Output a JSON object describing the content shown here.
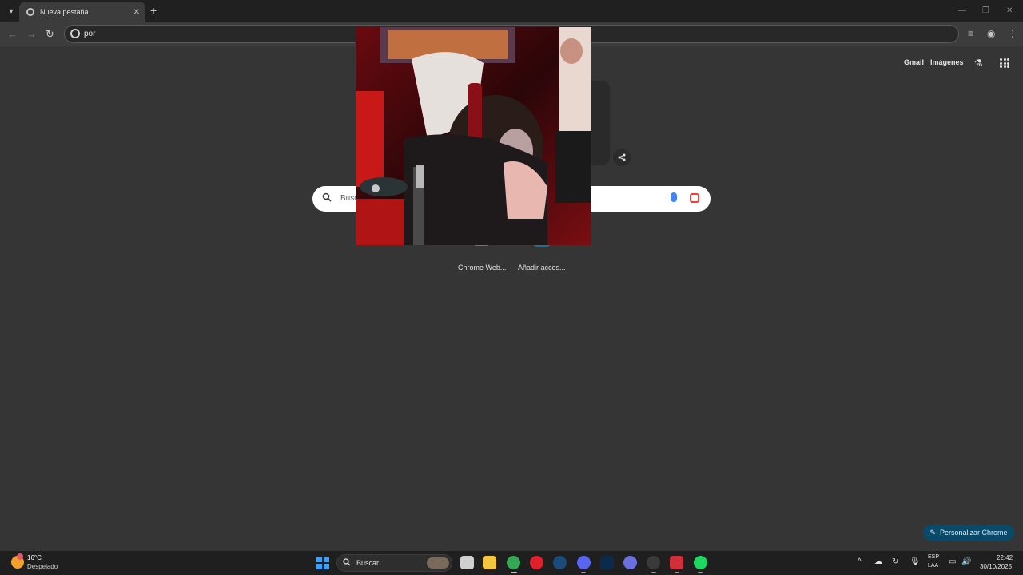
{
  "browser": {
    "tab": {
      "title": "Nueva pestaña",
      "close": "✕"
    },
    "new_tab": "+",
    "window_controls": {
      "minimize": "—",
      "maximize": "❐",
      "close": "✕"
    },
    "omnibox_value": "por"
  },
  "ntp": {
    "header_links": {
      "gmail": "Gmail",
      "images": "Imágenes"
    },
    "search_placeholder": "Busc",
    "shortcuts": [
      {
        "label": "Chrome Web..."
      },
      {
        "label": "Añadir acces..."
      }
    ],
    "customize_label": "Personalizar Chrome"
  },
  "taskbar": {
    "weather": {
      "temp": "16°C",
      "desc": "Despejado"
    },
    "search_label": "Buscar",
    "language": {
      "line1": "ESP",
      "line2": "LAA"
    },
    "clock": {
      "time": "22:42",
      "date": "30/10/2025"
    },
    "apps": [
      {
        "name": "task-view",
        "color": "#d0d0d0"
      },
      {
        "name": "file-explorer",
        "color": "#f5c542"
      },
      {
        "name": "chrome",
        "color": "#34a853"
      },
      {
        "name": "opera",
        "color": "#e0202a"
      },
      {
        "name": "steam",
        "color": "#1b4b7a"
      },
      {
        "name": "discord",
        "color": "#5865f2"
      },
      {
        "name": "photoshop",
        "color": "#0c2a4a"
      },
      {
        "name": "vpn",
        "color": "#6a70e0"
      },
      {
        "name": "obs",
        "color": "#3a3a3a"
      },
      {
        "name": "calendar",
        "color": "#d0303a"
      },
      {
        "name": "spotify",
        "color": "#1ed760"
      }
    ]
  },
  "colors": {
    "accent": "#0a4a68",
    "background": "#353535",
    "taskbar": "#1f1f1f"
  }
}
